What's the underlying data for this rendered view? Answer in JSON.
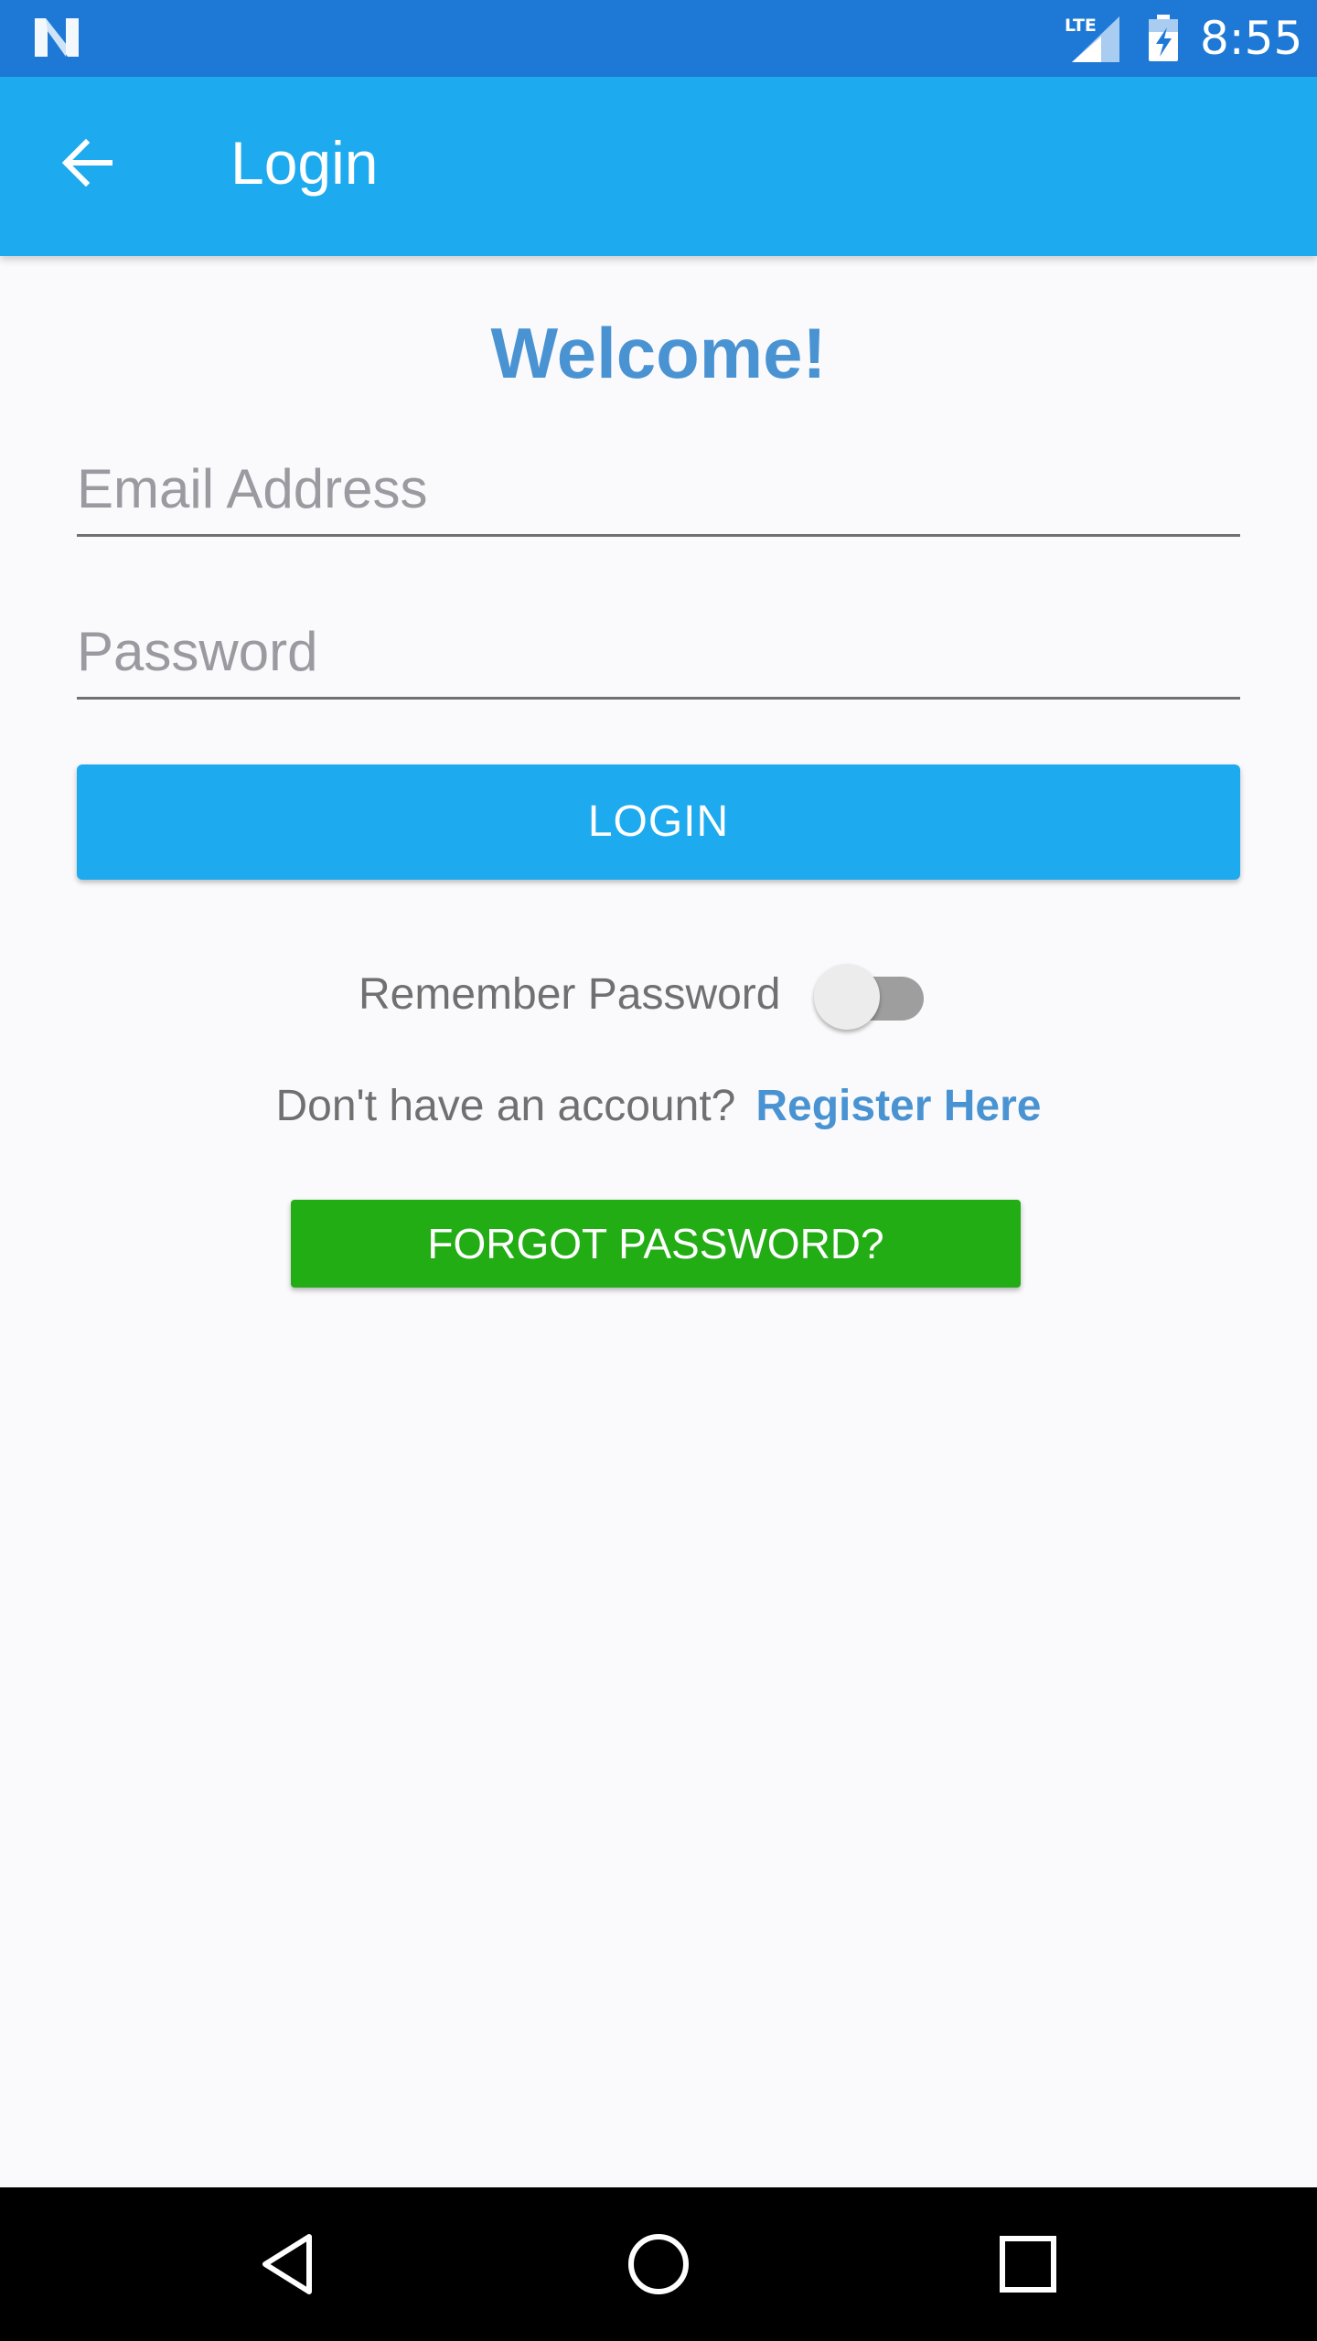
{
  "status_bar": {
    "time": "8:55",
    "network_label": "LTE",
    "icons": [
      "notification-n-icon",
      "lte-signal-icon",
      "battery-charging-icon"
    ]
  },
  "app_bar": {
    "title": "Login",
    "back_icon": "arrow-back-icon",
    "background": "#1eaaee"
  },
  "form": {
    "welcome": "Welcome!",
    "email_placeholder": "Email Address",
    "email_value": "",
    "password_placeholder": "Password",
    "password_value": "",
    "login_label": "LOGIN",
    "remember_label": "Remember Password",
    "remember_on": false,
    "register_prompt": "Don't have an account?",
    "register_link": "Register Here",
    "forgot_label": "FORGOT PASSWORD?"
  },
  "colors": {
    "status_bar": "#1e79d6",
    "primary": "#1eaaee",
    "link": "#4a93d2",
    "forgot": "#22ad14",
    "background": "#fafafc"
  },
  "nav_bar": {
    "icons": [
      "nav-back-icon",
      "nav-home-icon",
      "nav-recents-icon"
    ]
  }
}
